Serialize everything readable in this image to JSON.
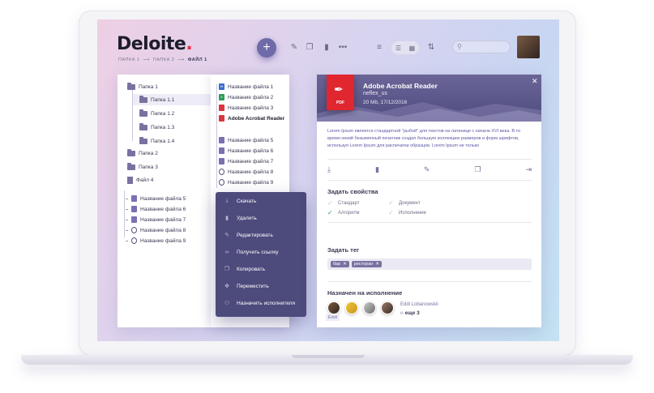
{
  "brand": {
    "name": "Deloite",
    "dot": "."
  },
  "breadcrumbs": [
    "ПАПКА 1",
    "ПАПКА 2",
    "ФАЙЛ 1"
  ],
  "breadcrumb_separator": "⟶",
  "toolbar": {
    "add_icon": "plus-icon",
    "icons": [
      "edit-icon",
      "copy-icon",
      "delete-icon",
      "more-icon",
      "filter-icon",
      "list-view-icon",
      "grid-view-icon",
      "sort-icon"
    ],
    "search_placeholder": ""
  },
  "tree": {
    "folders": [
      {
        "label": "Папка 1",
        "level": 0
      },
      {
        "label": "Папка 1.1",
        "level": 1,
        "selected": true
      },
      {
        "label": "Папка 1.2",
        "level": 1
      },
      {
        "label": "Папка 1.3",
        "level": 1
      },
      {
        "label": "Папка 1.4",
        "level": 1
      },
      {
        "label": "Папка 2",
        "level": 0
      },
      {
        "label": "Папка 3",
        "level": 0
      },
      {
        "label": "Файл 4",
        "level": 0
      }
    ],
    "files": [
      {
        "label": "Название файла 5",
        "kind": "doc"
      },
      {
        "label": "Название файла 6",
        "kind": "doc"
      },
      {
        "label": "Название файла 7",
        "kind": "video"
      },
      {
        "label": "Название файла 8",
        "kind": "sync"
      },
      {
        "label": "Название файла 9",
        "kind": "ring"
      }
    ]
  },
  "files_column": [
    {
      "label": "Название файла 1",
      "kind": "word"
    },
    {
      "label": "Название файла 2",
      "kind": "excel"
    },
    {
      "label": "Название файла 3",
      "kind": "pdf"
    },
    {
      "label": "Adobe Acrobat Reader",
      "kind": "pdf",
      "bold": true
    },
    {
      "label": "Название файла 5",
      "kind": "doc"
    },
    {
      "label": "Название файла 6",
      "kind": "doc"
    },
    {
      "label": "Название файла 7",
      "kind": "video"
    },
    {
      "label": "Название файла 8",
      "kind": "sync"
    },
    {
      "label": "Название файла 9",
      "kind": "ring"
    }
  ],
  "context_menu": [
    {
      "label": "Скачать",
      "icon": "download-icon",
      "glyph": "⤓"
    },
    {
      "label": "Удалить",
      "icon": "trash-icon",
      "glyph": "🗑"
    },
    {
      "label": "Редактировать",
      "icon": "pencil-icon",
      "glyph": "✎"
    },
    {
      "label": "Получить ссылку",
      "icon": "link-icon",
      "glyph": "∞"
    },
    {
      "label": "Копировать",
      "icon": "copy-icon",
      "glyph": "❐"
    },
    {
      "label": "Переместить",
      "icon": "move-icon",
      "glyph": "✥"
    },
    {
      "label": "Назначить исполнителя",
      "icon": "assign-user-icon",
      "glyph": "⚇"
    }
  ],
  "detail": {
    "file_type": "PDF",
    "title": "Adobe Acrobat Reader",
    "owner": "neflex_us",
    "meta": "20 Mb, 17/12/2016",
    "description": "Lorem Ipsum является стандартной \"рыбой\" для текстов на латинице с начала XVI века. В то время некий безымянный печатник создал большую коллекцию размеров и форм шрифтов, используя Lorem Ipsum для распечатки образцов. Lorem Ipsum не только",
    "actions": [
      "download-icon",
      "trash-icon",
      "pencil-icon",
      "copy-icon",
      "export-icon"
    ],
    "properties_title": "Задать свойства",
    "properties": [
      {
        "label": "Стандарт",
        "checked": false
      },
      {
        "label": "Документ",
        "checked": false
      },
      {
        "label": "Алгоритм",
        "checked": true
      },
      {
        "label": "Исполнение",
        "checked": false
      }
    ],
    "tag_title": "Задать тег",
    "tags": [
      "бар",
      "ресторан"
    ],
    "tag_remove": "✕",
    "assigned_title": "Назначен на исполнение",
    "assignee_hover": "Eddi",
    "assignee_name": "Eddi Lobanowskii",
    "more_prefix": "и",
    "more_label": "еще 3",
    "close_glyph": "✕"
  },
  "colors": {
    "accent": "#6f6aa8",
    "menu_bg": "#4d4a7c",
    "pdf_red": "#e0262f",
    "check_green": "#2f9b58",
    "logo_dot": "#e8324b"
  }
}
